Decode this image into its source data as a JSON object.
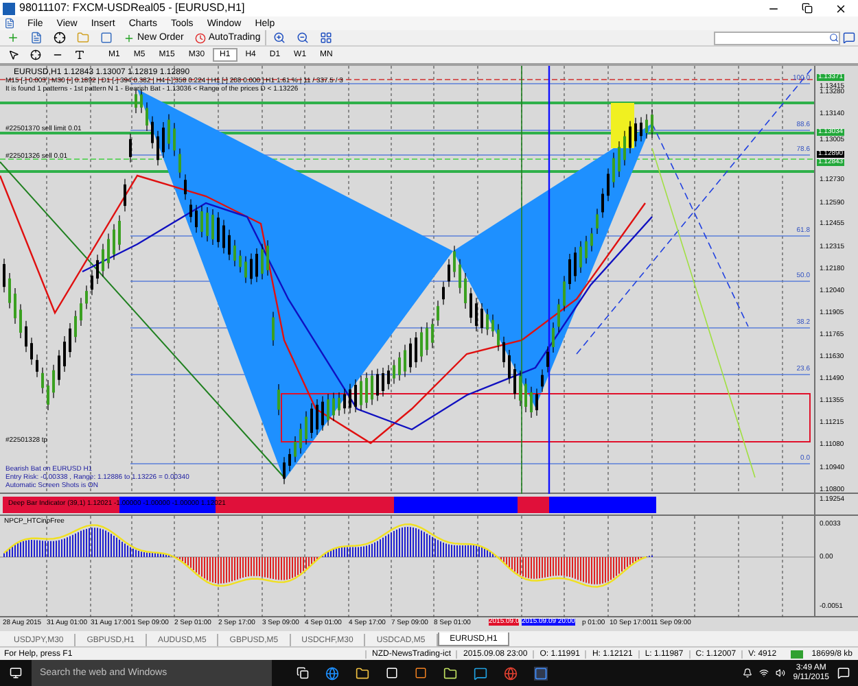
{
  "window": {
    "title": "98011107: FXCM-USDReal05 - [EURUSD,H1]"
  },
  "menu": [
    "File",
    "View",
    "Insert",
    "Charts",
    "Tools",
    "Window",
    "Help"
  ],
  "toolbar": {
    "new_order": "New Order",
    "auto_trading": "AutoTrading"
  },
  "timeframes": [
    {
      "label": "M1",
      "selected": false
    },
    {
      "label": "M5",
      "selected": false
    },
    {
      "label": "M15",
      "selected": false
    },
    {
      "label": "M30",
      "selected": false
    },
    {
      "label": "H1",
      "selected": true
    },
    {
      "label": "H4",
      "selected": false
    },
    {
      "label": "D1",
      "selected": false
    },
    {
      "label": "W1",
      "selected": false
    },
    {
      "label": "MN",
      "selected": false
    }
  ],
  "chart": {
    "header": "EURUSD,H1  1.12843 1.13007 1.12819 1.12890",
    "info_line": "M15 [-] 0.003 | M30 [-] 0.1892 | D1 [-] 394 0.382 | H4 [-] 358 0.224 | H1 [-] 208 0.000 | H1 1.61 % | 11 / 337.5 / 3",
    "pattern_line": "It is found 1 patterns - 1st pattern N 1 - Bearish Bat - 1.13036 < Range of the prices D < 1.13226",
    "order_labels": [
      "#22501370 sell limit 0.01",
      "#22501326 sell 0.01",
      "#22501328 tp"
    ],
    "notes": [
      "Bearish Bat on EURUSD H1",
      "Entry Risk: -0.00338 , Range: 1.12886 to 1.13226 = 0.00340",
      "Automatic Screen Shots is ON"
    ],
    "fib_levels": [
      "100.0",
      "88.6",
      "78.6",
      "61.8",
      "50.0",
      "38.2",
      "23.6",
      "0.0"
    ],
    "price_axis": [
      "1.13415",
      "1.13280",
      "1.13140",
      "1.13005",
      "1.12730",
      "1.12590",
      "1.12455",
      "1.12315",
      "1.12180",
      "1.12040",
      "1.11905",
      "1.11765",
      "1.11630",
      "1.11490",
      "1.11355",
      "1.11215",
      "1.11080",
      "1.10940",
      "1.10800"
    ],
    "price_markers": [
      {
        "text": "1.13371",
        "color": "#22a83a"
      },
      {
        "text": "1.13034",
        "color": "#22a83a"
      },
      {
        "text": "1.12890",
        "color": "#000000"
      },
      {
        "text": "1.12843",
        "color": "#22a83a"
      }
    ]
  },
  "deep_bar": {
    "label": "Deep Bar Indicator (39,1) 1.12021 -1.00000 -1.00000 -1.00000 1.12021",
    "axis": "1.19254"
  },
  "oscillator": {
    "label": "NPCP_HTCinpFree",
    "axis": [
      "0.0033",
      "0.00",
      "-0.0051"
    ]
  },
  "time_axis": [
    "28 Aug 2015",
    "31 Aug 01:00",
    "31 Aug 17:00",
    "1 Sep 09:00",
    "2 Sep 01:00",
    "2 Sep 17:00",
    "3 Sep 09:00",
    "4 Sep 01:00",
    "4 Sep 17:00",
    "7 Sep 09:00",
    "8 Sep 01:00",
    "p 01:00",
    "10 Sep 17:00",
    "11 Sep 09:00"
  ],
  "time_markers": [
    {
      "text": "2015.09.0",
      "color": "#e0102a"
    },
    {
      "text": "2015.09.09 20:00",
      "color": "#1010ff"
    }
  ],
  "tabs": [
    {
      "label": "USDJPY,M30",
      "selected": false
    },
    {
      "label": "GBPUSD,H1",
      "selected": false
    },
    {
      "label": "AUDUSD,M5",
      "selected": false
    },
    {
      "label": "GBPUSD,M5",
      "selected": false
    },
    {
      "label": "USDCHF,M30",
      "selected": false
    },
    {
      "label": "USDCAD,M5",
      "selected": false
    },
    {
      "label": "EURUSD,H1",
      "selected": true
    }
  ],
  "status_bar": {
    "help": "For Help, press F1",
    "profile": "NZD-NewsTrading-ict",
    "time": "2015.09.08 23:00",
    "open": "O: 1.11991",
    "high": "H: 1.12121",
    "low": "L: 1.11987",
    "close": "C: 1.12007",
    "volume": "V: 4912",
    "traffic": "18699/8 kb"
  },
  "taskbar": {
    "search": {
      "placeholder": "Search the web and Windows"
    },
    "clock": "3:49 AM",
    "date": "9/11/2015"
  }
}
